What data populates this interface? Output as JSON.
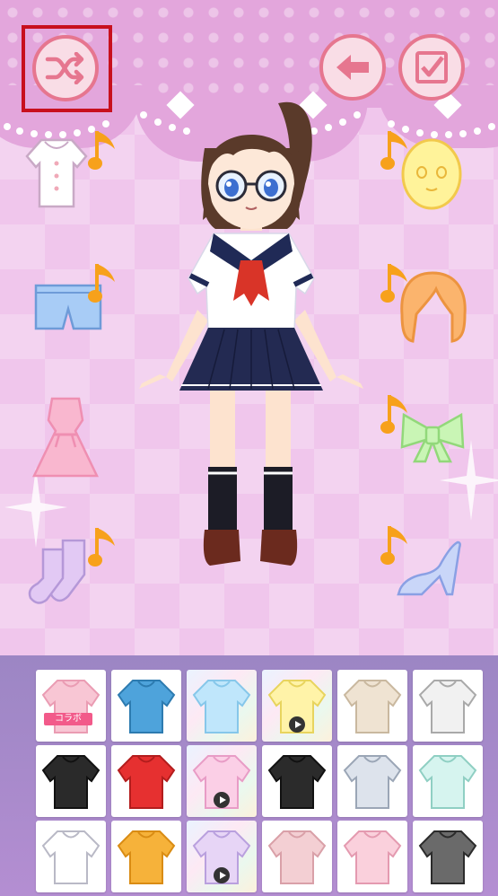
{
  "top_bar": {
    "shuffle_icon": "shuffle-icon",
    "back_icon": "arrow-left-icon",
    "confirm_icon": "checkbox-check-icon"
  },
  "colors": {
    "button_border": "#e6768f",
    "button_fill": "#f9dde6",
    "highlight": "#c8101e",
    "panel_top": "#9c86c4",
    "panel_bottom": "#b48ed2"
  },
  "category_items": {
    "left": [
      "blouse-icon",
      "shorts-icon",
      "dress-icon",
      "socks-icon"
    ],
    "right": [
      "face-icon",
      "hair-icon",
      "bow-icon",
      "heel-shoe-icon"
    ],
    "note_icon": "music-note-icon"
  },
  "wardrobe": {
    "tiles": [
      {
        "item": "pink-blouse",
        "badge": "コラボ"
      },
      {
        "item": "blue-cardigan",
        "badge": ""
      },
      {
        "item": "blue-offshoulder-top",
        "badge": ""
      },
      {
        "item": "yellow-offshoulder-top",
        "badge": "",
        "video": true
      },
      {
        "item": "beige-sweater",
        "badge": ""
      },
      {
        "item": "grey-hoodie",
        "badge": ""
      },
      {
        "item": "black-tank-top",
        "badge": ""
      },
      {
        "item": "red-cardigan",
        "badge": ""
      },
      {
        "item": "pink-offshoulder-top",
        "badge": "",
        "video": true
      },
      {
        "item": "black-turtleneck",
        "badge": ""
      },
      {
        "item": "grey-shirt",
        "badge": ""
      },
      {
        "item": "mint-hoodie",
        "badge": ""
      },
      {
        "item": "white-blouse",
        "badge": ""
      },
      {
        "item": "orange-cardigan",
        "badge": ""
      },
      {
        "item": "lilac-offshoulder-top",
        "badge": "",
        "video": true
      },
      {
        "item": "pink-sweater",
        "badge": ""
      },
      {
        "item": "pink-hoodie",
        "badge": ""
      },
      {
        "item": "black-hoodie",
        "badge": ""
      }
    ]
  }
}
